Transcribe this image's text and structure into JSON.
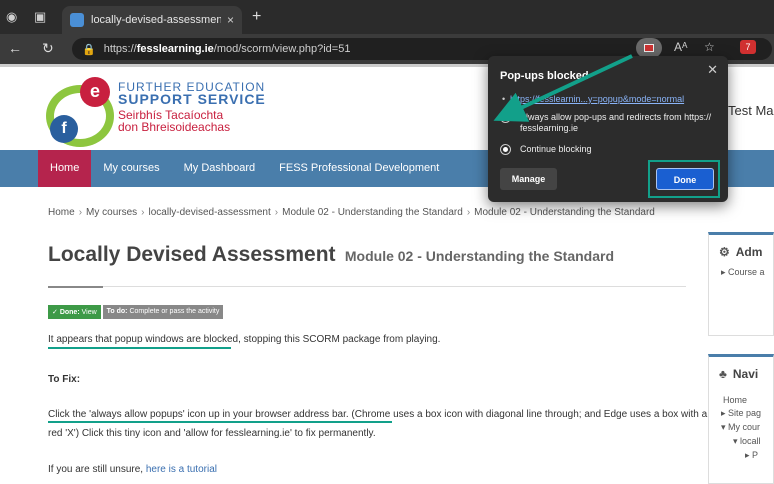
{
  "browser": {
    "tab_title": "locally-devised-assessment: Mod",
    "new_tab": "+",
    "url_prefix": "https://",
    "url_domain": "fesslearning.ie",
    "url_path": "/mod/scorm/view.php?id=51",
    "reading_mode": "Aᴬ"
  },
  "site": {
    "logo_line1": "FURTHER EDUCATION",
    "logo_line2": "SUPPORT SERVICE",
    "logo_line3": "Seirbhís Tacaíochta",
    "logo_line4": "don Bhreisoideachas",
    "user_name": "Test Ma"
  },
  "nav": {
    "items": [
      "Home",
      "My courses",
      "My Dashboard",
      "FESS Professional Development"
    ]
  },
  "breadcrumb": {
    "items": [
      "Home",
      "My courses",
      "locally-devised-assessment",
      "Module 02 - Understanding the Standard",
      "Module 02 - Understanding the Standard"
    ]
  },
  "page": {
    "title": "Locally Devised Assessment",
    "subtitle": "Module 02 - Understanding the Standard",
    "badge_done_label": "Done:",
    "badge_done_value": "View",
    "badge_todo_label": "To do:",
    "badge_todo_value": "Complete or pass the activity",
    "p1_highlight": "It appears that popup windows are blocked",
    "p1_rest": ", stopping this SCORM package from playing.",
    "to_fix": "To Fix:",
    "p2_line1": "Click the 'always allow popups' icon up in your browser address bar. (Chrome uses a box icon with diagonal line through; and Edge uses a box with a",
    "p2_line2": "red 'X') Click this tiny icon and 'allow for fesslearning.ie' to fix permanently.",
    "p3_text": "If you are still unsure, ",
    "p3_link": "here is a tutorial"
  },
  "blocks": {
    "admin_title": "Adm",
    "admin_item": "Course a",
    "nav_title": "Navi",
    "nav_items": [
      "Home",
      "Site pag",
      "My cour",
      "locall",
      "P"
    ]
  },
  "popup": {
    "title": "Pop-ups blocked",
    "link": "https://fesslearnin...y=popup&mode=normal",
    "option_allow": "Always allow pop-ups and redirects from https://",
    "option_allow_domain": "fesslearning.ie",
    "option_block": "Continue blocking",
    "manage_label": "Manage",
    "done_label": "Done"
  },
  "colors": {
    "nav_bg": "#4a7eaa",
    "nav_active": "#b5244d",
    "highlight_teal": "#12a08a",
    "done_button": "#1a5fd1"
  }
}
